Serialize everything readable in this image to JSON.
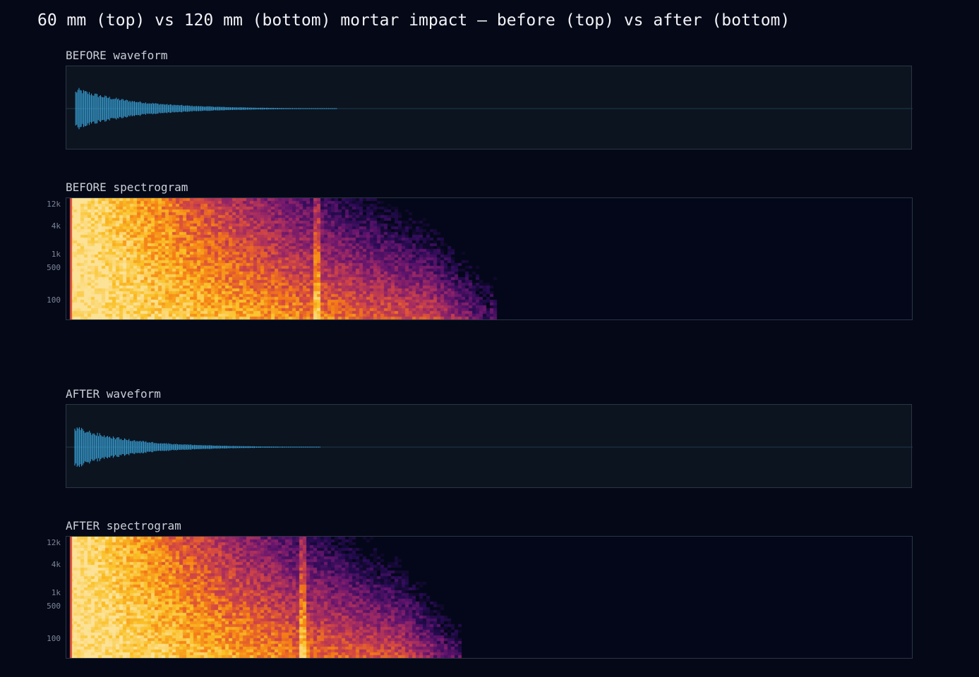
{
  "title": "60 mm (top) vs 120 mm (bottom) mortar impact — before (top) vs after (bottom)",
  "colors": {
    "background": "#050817",
    "waveform": "#3aa8e0",
    "panel_border": "#2b3644",
    "colormap": "inferno"
  },
  "chart_data": [
    {
      "type": "line",
      "id": "before-waveform",
      "label": "BEFORE waveform",
      "grid": false,
      "envelope": {
        "onset": 0.011,
        "decay_constant": 0.07,
        "end": 0.32
      }
    },
    {
      "type": "heatmap",
      "id": "before-spectrogram",
      "label": "BEFORE spectrogram",
      "yticks": [
        "12k",
        "4k",
        "1k",
        "500",
        "100"
      ],
      "yscale": "log",
      "envelope": {
        "onset": 0.004,
        "end": 0.505,
        "transient_at": 0.295
      }
    },
    {
      "type": "line",
      "id": "after-waveform",
      "label": "AFTER waveform",
      "grid": false,
      "envelope": {
        "onset": 0.01,
        "decay_constant": 0.065,
        "end": 0.3
      }
    },
    {
      "type": "heatmap",
      "id": "after-spectrogram",
      "label": "AFTER spectrogram",
      "yticks": [
        "12k",
        "4k",
        "1k",
        "500",
        "100"
      ],
      "yscale": "log",
      "envelope": {
        "onset": 0.004,
        "end": 0.465,
        "transient_at": 0.278
      }
    }
  ]
}
